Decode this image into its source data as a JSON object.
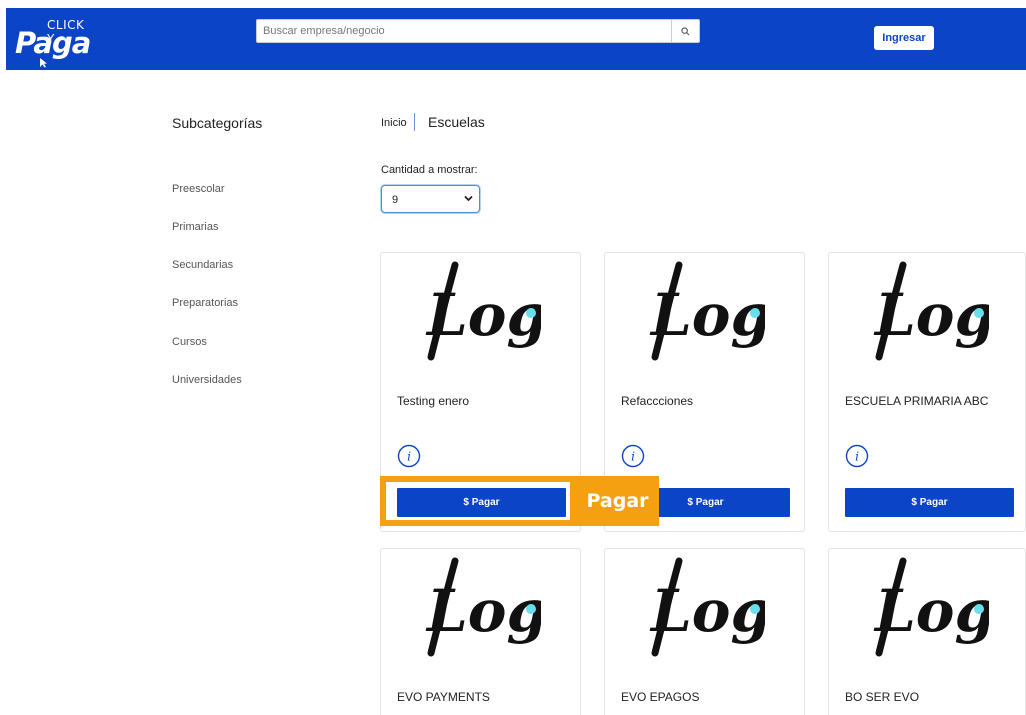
{
  "header": {
    "brand_top": "CLICK Y",
    "brand_main": "Paga",
    "search_placeholder": "Buscar empresa/negocio",
    "login_label": "Ingresar",
    "color": "#0b44c6"
  },
  "sidebar": {
    "title": "Subcategorías",
    "items": [
      {
        "label": "Preescolar"
      },
      {
        "label": "Primarias"
      },
      {
        "label": "Secundarias"
      },
      {
        "label": "Preparatorias"
      },
      {
        "label": "Cursos"
      },
      {
        "label": "Universidades"
      }
    ]
  },
  "breadcrumb": {
    "home": "Inicio",
    "current": "Escuelas"
  },
  "quantity": {
    "label": "Cantidad a mostrar:",
    "selected": "9"
  },
  "cards": [
    {
      "name": "Testing enero",
      "pay_label": "$ Pagar",
      "logo_text": "Logo"
    },
    {
      "name": "Refaccciones",
      "pay_label": "$ Pagar",
      "logo_text": "Logo"
    },
    {
      "name": "ESCUELA PRIMARIA ABC",
      "pay_label": "$ Pagar",
      "logo_text": "Logo"
    },
    {
      "name": "EVO PAYMENTS",
      "logo_text": "Logo"
    },
    {
      "name": "EVO EPAGOS",
      "logo_text": "Logo"
    },
    {
      "name": "BO SER EVO",
      "logo_text": "Logo"
    }
  ],
  "highlight": {
    "label": "Pagar",
    "color": "#f5a011"
  }
}
